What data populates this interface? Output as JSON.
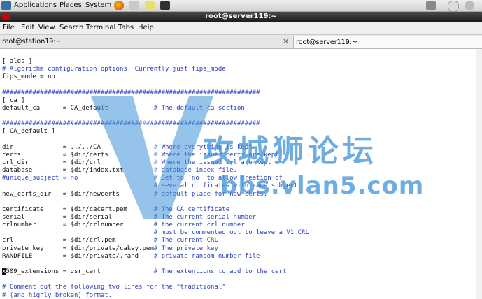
{
  "panel": {
    "applications": "Applications",
    "places": "Places",
    "system": "System"
  },
  "window": {
    "title": "root@server119:~"
  },
  "menu": [
    "File",
    "Edit",
    "View",
    "Search",
    "Terminal",
    "Tabs",
    "Help"
  ],
  "tabs": [
    {
      "label": "root@station19:~"
    },
    {
      "label": "root@server119:~"
    }
  ],
  "watermark": {
    "cn": "攻城狮论坛",
    "url": "bbs.vlan5.com"
  },
  "terminal_lines": [
    {
      "t": "[ algs ]",
      "cls": ""
    },
    {
      "t": "# Algorithm configuration options. Currently just fips_mode",
      "cls": "c"
    },
    {
      "t": "fips_mode = no",
      "cls": ""
    },
    {
      "t": "",
      "cls": ""
    },
    {
      "t": "####################################################################",
      "cls": "c"
    },
    {
      "t": "[ ca ]",
      "cls": ""
    },
    {
      "t": "default_ca      = CA_default            # The default ca section",
      "cls": "mix"
    },
    {
      "t": "",
      "cls": ""
    },
    {
      "t": "####################################################################",
      "cls": "c"
    },
    {
      "t": "[ CA_default ]",
      "cls": ""
    },
    {
      "t": "",
      "cls": ""
    },
    {
      "t": "dir             = ../../CA              # Where everything is kept",
      "cls": "mix"
    },
    {
      "t": "certs           = $dir/certs            # Where the issued certs are kept",
      "cls": "mix"
    },
    {
      "t": "crl_dir         = $dir/crl              # Where the issued crl are kept",
      "cls": "mix"
    },
    {
      "t": "database        = $dir/index.txt        # database index file.",
      "cls": "mix"
    },
    {
      "t": "#unique_subject = no                    # Set to 'no' to allow creation of",
      "cls": "c"
    },
    {
      "t": "                                        # several ctificates with same subject.",
      "cls": "c"
    },
    {
      "t": "new_certs_dir   = $dir/newcerts         # default place for new certs.",
      "cls": "mix"
    },
    {
      "t": "",
      "cls": ""
    },
    {
      "t": "certificate     = $dir/cacert.pem       # The CA certificate",
      "cls": "mix"
    },
    {
      "t": "serial          = $dir/serial           # The current serial number",
      "cls": "mix"
    },
    {
      "t": "crlnumber       = $dir/crlnumber        # the current crl number",
      "cls": "mix"
    },
    {
      "t": "                                        # must be commented out to leave a V1 CRL",
      "cls": "c"
    },
    {
      "t": "crl             = $dir/crl.pem          # The current CRL",
      "cls": "mix"
    },
    {
      "t": "private_key     = $dir/private/cakey.pem# The private key",
      "cls": "mix"
    },
    {
      "t": "RANDFILE        = $dir/private/.rand    # private random number file",
      "cls": "mix"
    },
    {
      "t": "",
      "cls": ""
    },
    {
      "t": "x509_extensions = usr_cert              # The extentions to add to the cert",
      "cls": "cur"
    },
    {
      "t": "",
      "cls": ""
    },
    {
      "t": "# Comment out the following two lines for the \"traditional\"",
      "cls": "c"
    },
    {
      "t": "# (and highly broken) format.",
      "cls": "c"
    }
  ]
}
